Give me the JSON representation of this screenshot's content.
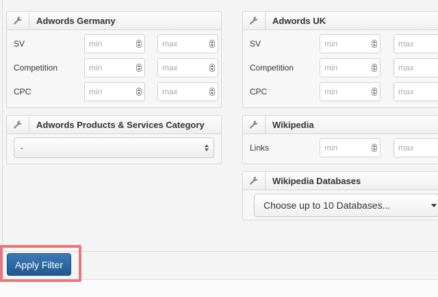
{
  "panels": {
    "adwords_germany": {
      "title": "Adwords Germany",
      "rows": [
        {
          "label": "SV",
          "min_placeholder": "min",
          "max_placeholder": "max"
        },
        {
          "label": "Competition",
          "min_placeholder": "min",
          "max_placeholder": "max"
        },
        {
          "label": "CPC",
          "min_placeholder": "min",
          "max_placeholder": "max"
        }
      ]
    },
    "adwords_uk": {
      "title": "Adwords UK",
      "rows": [
        {
          "label": "SV",
          "min_placeholder": "min",
          "max_placeholder": "max"
        },
        {
          "label": "Competition",
          "min_placeholder": "min",
          "max_placeholder": "max"
        },
        {
          "label": "CPC",
          "min_placeholder": "min",
          "max_placeholder": "max"
        }
      ]
    },
    "adwords_category": {
      "title": "Adwords Products & Services Category",
      "selected": "-"
    },
    "wikipedia": {
      "title": "Wikipedia",
      "rows": [
        {
          "label": "Links",
          "min_placeholder": "min",
          "max_placeholder": "max"
        }
      ]
    },
    "wikipedia_databases": {
      "title": "Wikipedia Databases",
      "placeholder": "Choose up to 10 Databases..."
    }
  },
  "footer": {
    "apply_label": "Apply Filter"
  },
  "icons": {
    "panel_header": "wrench-icon"
  },
  "colors": {
    "apply_button": "#2b66a1",
    "highlight_border": "#e8767a"
  }
}
